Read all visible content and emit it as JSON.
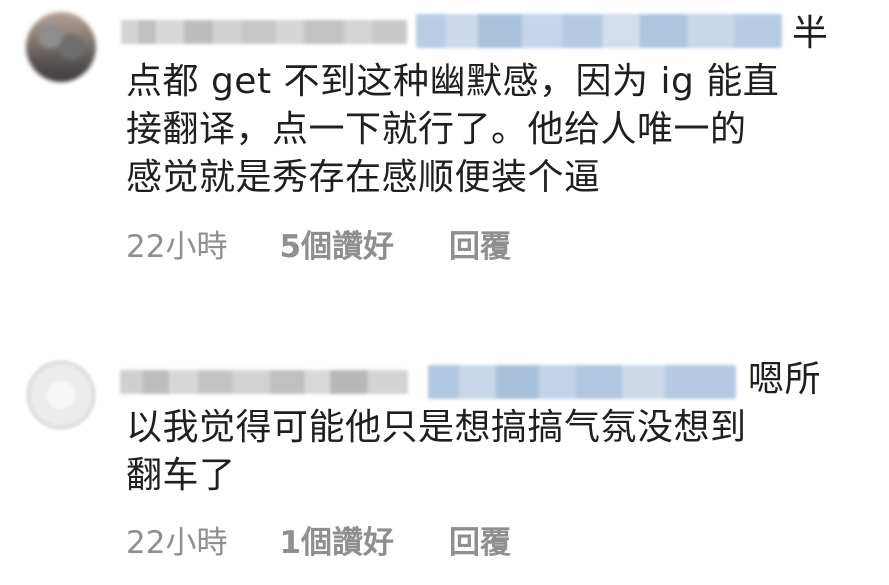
{
  "comments": [
    {
      "body_lines": [
        "半",
        "点都 get 不到这种幽默感，因为 ig 能直",
        "接翻译，点一下就行了。他给人唯一的",
        "感觉就是秀存在感顺便装个逼"
      ],
      "time": "22小時",
      "likes": "5個讚好",
      "reply": "回覆"
    },
    {
      "body_lines": [
        "嗯所",
        "以我觉得可能他只是想搞搞气氛没想到",
        "翻车了"
      ],
      "time": "22小時",
      "likes": "1個讚好",
      "reply": "回覆"
    }
  ],
  "colors": {
    "text": "#1f1f1f",
    "meta": "#8f8f8f",
    "mention": "#b8cde5"
  }
}
